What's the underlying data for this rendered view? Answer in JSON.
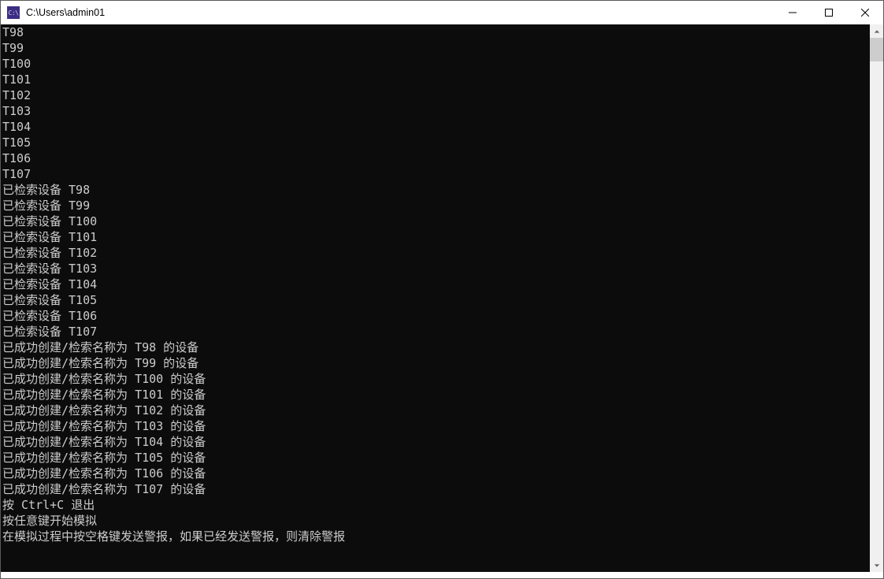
{
  "window": {
    "title": "C:\\Users\\admin01",
    "icon_text": "C:\\"
  },
  "console_lines": [
    "T98",
    "T99",
    "T100",
    "T101",
    "T102",
    "T103",
    "T104",
    "T105",
    "T106",
    "T107",
    "已检索设备 T98",
    "已检索设备 T99",
    "已检索设备 T100",
    "已检索设备 T101",
    "已检索设备 T102",
    "已检索设备 T103",
    "已检索设备 T104",
    "已检索设备 T105",
    "已检索设备 T106",
    "已检索设备 T107",
    "已成功创建/检索名称为 T98 的设备",
    "已成功创建/检索名称为 T99 的设备",
    "已成功创建/检索名称为 T100 的设备",
    "已成功创建/检索名称为 T101 的设备",
    "已成功创建/检索名称为 T102 的设备",
    "已成功创建/检索名称为 T103 的设备",
    "已成功创建/检索名称为 T104 的设备",
    "已成功创建/检索名称为 T105 的设备",
    "已成功创建/检索名称为 T106 的设备",
    "已成功创建/检索名称为 T107 的设备",
    "按 Ctrl+C 退出",
    "按任意键开始模拟",
    "在模拟过程中按空格键发送警报，如果已经发送警报，则清除警报",
    ""
  ]
}
